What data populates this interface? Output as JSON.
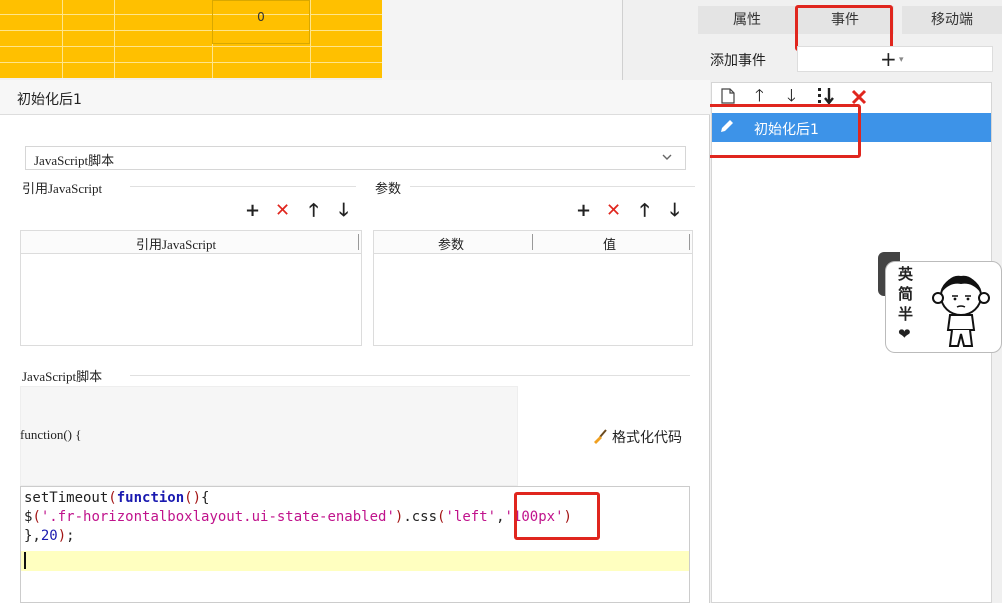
{
  "sheet": {
    "cell_value": "0"
  },
  "right_panel": {
    "tabs": [
      "属性",
      "事件",
      "移动端"
    ],
    "add_event_label": "添加事件",
    "add_plus": "+",
    "add_caret": "▾",
    "toolbar_icons": [
      "new-doc-icon",
      "arrow-up-icon",
      "arrow-down-icon",
      "sort-down-icon",
      "delete-icon"
    ],
    "events": [
      {
        "label": "初始化后1",
        "selected": true
      }
    ]
  },
  "sticker": {
    "text": "英简半❤"
  },
  "dialog": {
    "title": "初始化后1",
    "script_type": "JavaScript脚本",
    "ref_section": "引用JavaScript",
    "ref_table_header": "引用JavaScript",
    "param_section": "参数",
    "param_headers": [
      "参数",
      "值"
    ],
    "script_section": "JavaScript脚本",
    "function_header": "function() {",
    "format_button": "格式化代码",
    "code": [
      "setTimeout(function(){",
      "$('.fr-horizontalboxlayout.ui-state-enabled').css('left','100px')",
      "},20);"
    ]
  },
  "colors": {
    "sheet_fill": "#ffc000",
    "selection_blue": "#3d93e8",
    "annotation_red": "#e0261e",
    "cursor_line": "#ffffc0"
  }
}
